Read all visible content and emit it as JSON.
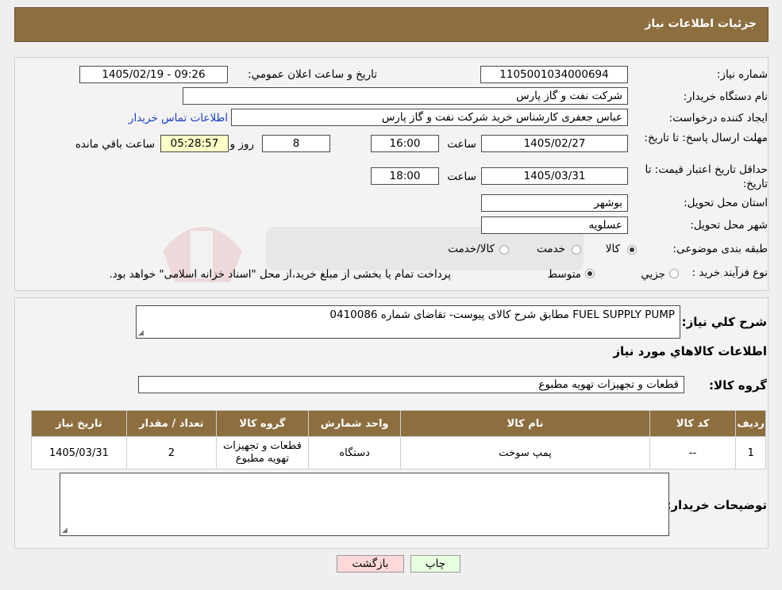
{
  "header": {
    "title": "جزئیات اطلاعات نیاز"
  },
  "form": {
    "need_number_label": "شماره نیاز:",
    "need_number": "1105001034000694",
    "announce_label": "تاریخ و ساعت اعلان عمومي:",
    "announce_value": "1405/02/19 - 09:26",
    "buyer_org_label": "نام دستگاه خريدار:",
    "buyer_org": "شرکت نفت و گاز پارس",
    "creator_label": "ايجاد كننده درخواست:",
    "creator": "عباس  جعفری کارشناس خرید  شرکت نفت و گاز پارس",
    "contact_link": "اطلاعات تماس خريدار",
    "reply_deadline_label": "مهلت ارسال پاسخ: تا تاريخ:",
    "reply_date": "1405/02/27",
    "time_label": "ساعت",
    "reply_time": "16:00",
    "days_value": "8",
    "days_label": "روز و",
    "remaining_time": "05:28:57",
    "remaining_label": "ساعت باقي مانده",
    "validity_label": "حداقل تاريخ اعتبار قيمت: تا تاريخ:",
    "validity_date": "1405/03/31",
    "validity_time": "18:00",
    "province_label": "استان محل تحويل:",
    "province": "بوشهر",
    "city_label": "شهر محل تحويل:",
    "city": "عسلويه",
    "category_label": "طبقه بندی موضوعی:",
    "category_options": [
      "كالا",
      "خدمت",
      "كالا/خدمت"
    ],
    "process_label": "نوع فرآيند خريد :",
    "process_options": [
      "جزيي",
      "متوسط"
    ],
    "process_note": "پرداخت تمام يا بخشی از مبلغ خريد،از محل \"اسناد خزانه اسلامی\" خواهد بود."
  },
  "details": {
    "summary_label": "شرح كلي نياز:",
    "summary": "FUEL SUPPLY PUMP مطابق شرح کالای پیوست- تقاضای شماره 0410086",
    "goods_info_title": "اطلاعات كالاهاي مورد نياز",
    "goods_group_label": "گروه كالا:",
    "goods_group": "قطعات و تجهيزات تهويه مطبوع",
    "table": {
      "headers": [
        "رديف",
        "كد كالا",
        "نام كالا",
        "واحد شمارش",
        "گروه كالا",
        "تعداد / مقدار",
        "تاريخ نياز"
      ],
      "rows": [
        [
          "1",
          "--",
          "پمپ سوخت",
          "دستگاه",
          "قطعات و تجهيزات تهويه مطبوع",
          "2",
          "1405/03/31"
        ]
      ]
    },
    "buyer_notes_label": "توضيحات خريدار:"
  },
  "buttons": {
    "print": "چاپ",
    "back": "بازگشت"
  },
  "colors": {
    "header": "#8c6e3f",
    "back_button": "#ffd9d9",
    "print_button": "#e8ffe0"
  }
}
